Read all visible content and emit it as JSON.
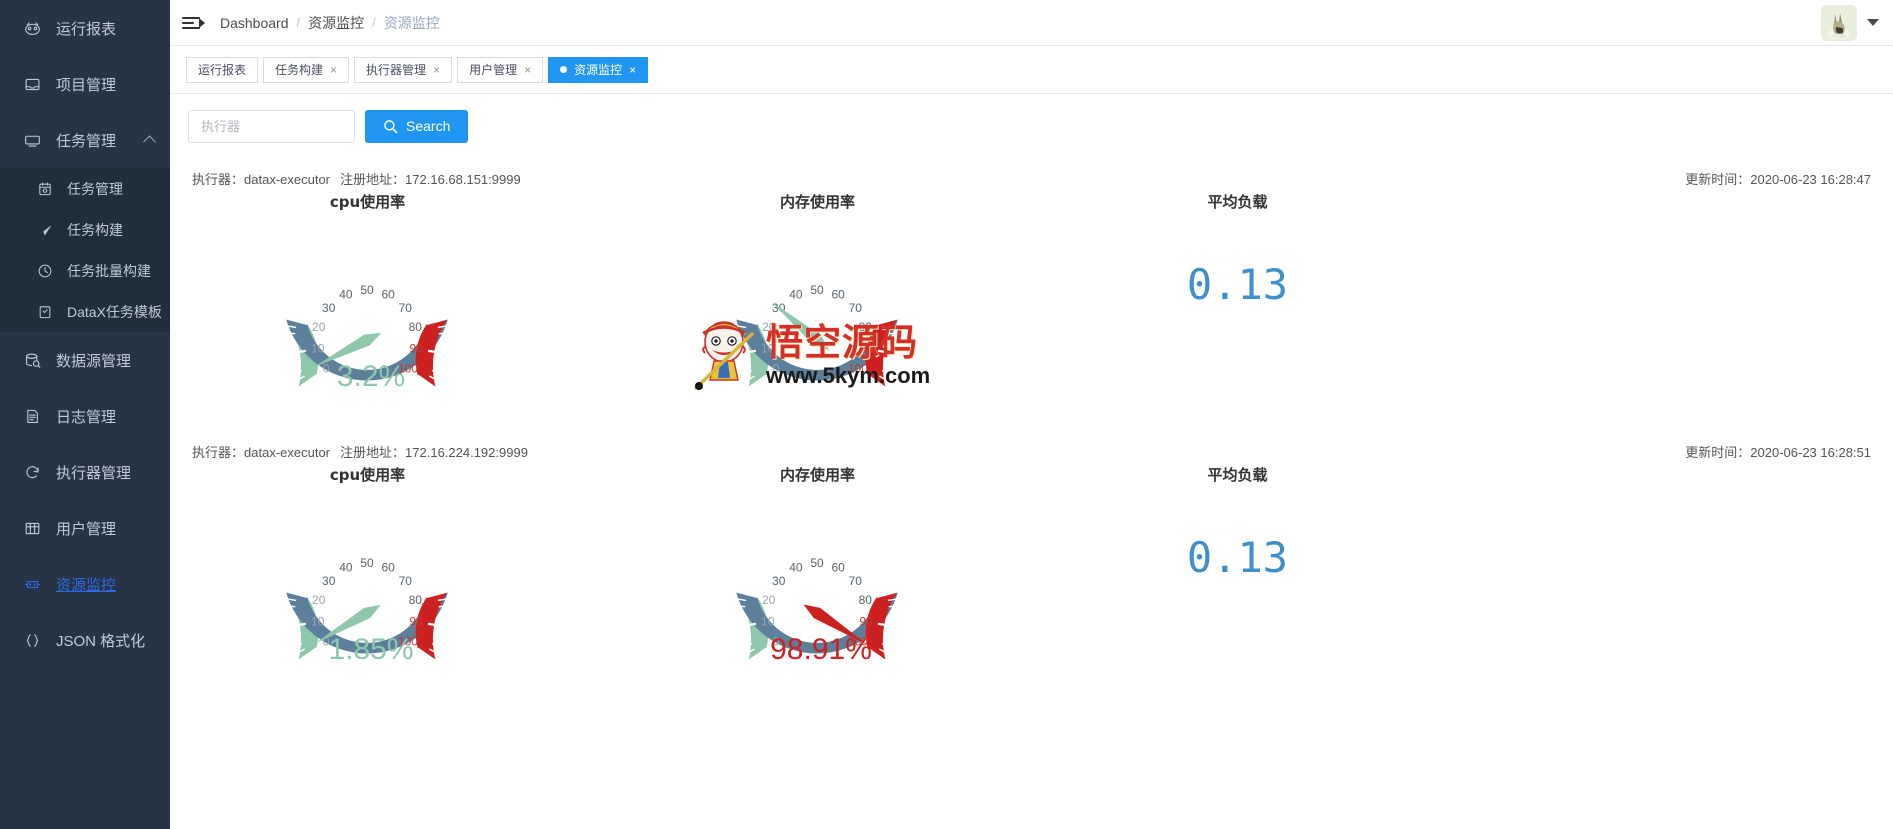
{
  "sidebar": {
    "items": [
      {
        "label": "运行报表",
        "icon": "dashboard-icon",
        "type": "item"
      },
      {
        "label": "项目管理",
        "icon": "project-icon",
        "type": "item"
      },
      {
        "label": "任务管理",
        "icon": "monitor-icon",
        "type": "group",
        "expanded": true,
        "children": [
          {
            "label": "任务管理",
            "icon": "calendar-icon"
          },
          {
            "label": "任务构建",
            "icon": "send-icon"
          },
          {
            "label": "任务批量构建",
            "icon": "clock-circle-icon"
          },
          {
            "label": "DataX任务模板",
            "icon": "template-icon"
          }
        ]
      },
      {
        "label": "数据源管理",
        "icon": "database-icon",
        "type": "item"
      },
      {
        "label": "日志管理",
        "icon": "document-icon",
        "type": "item"
      },
      {
        "label": "执行器管理",
        "icon": "refresh-icon",
        "type": "item"
      },
      {
        "label": "用户管理",
        "icon": "grid-icon",
        "type": "item"
      },
      {
        "label": "资源监控",
        "icon": "monitor-chip-icon",
        "type": "item",
        "active": true
      },
      {
        "label": "JSON 格式化",
        "icon": "braces-icon",
        "type": "item"
      }
    ]
  },
  "header": {
    "menu_icon": "hamburger-collapse-icon",
    "breadcrumb": [
      "Dashboard",
      "资源监控",
      "资源监控"
    ],
    "avatar_icon": "user-avatar",
    "avatar_caret_icon": "chevron-down-icon"
  },
  "tabs": [
    {
      "label": "运行报表",
      "closable": false,
      "active": false
    },
    {
      "label": "任务构建",
      "closable": true,
      "active": false
    },
    {
      "label": "执行器管理",
      "closable": true,
      "active": false
    },
    {
      "label": "用户管理",
      "closable": true,
      "active": false
    },
    {
      "label": "资源监控",
      "closable": true,
      "active": true
    }
  ],
  "tab_close_glyph": "×",
  "search": {
    "placeholder": "执行器",
    "value": "",
    "button_label": "Search",
    "button_icon": "search-icon"
  },
  "labels": {
    "executor_prefix": "执行器：",
    "address_prefix": "注册地址：",
    "updated_prefix": "更新时间：",
    "cpu_title": "cpu使用率",
    "mem_title": "内存使用率",
    "load_title": "平均负载"
  },
  "colors": {
    "accent": "#2095f2",
    "sidebar_bg": "#263445",
    "sidebar_sub_bg": "#1f2d3d",
    "gauge_green": "#8fc7ab",
    "gauge_blue": "#5c7f9c",
    "gauge_red": "#cd2121",
    "load_blue": "#3f8fcb"
  },
  "executors": [
    {
      "name": "datax-executor",
      "address": "172.16.68.151:9999",
      "updated": "2020-06-23 16:28:47",
      "cpu": {
        "value": 3.2,
        "display": "3.2%",
        "color": "#8fc7ab"
      },
      "mem": {
        "value": 30.0,
        "display": "",
        "color": "#8fc7ab"
      },
      "load": "0.13"
    },
    {
      "name": "datax-executor",
      "address": "172.16.224.192:9999",
      "updated": "2020-06-23 16:28:51",
      "cpu": {
        "value": 1.85,
        "display": "1.85%",
        "color": "#8fc7ab"
      },
      "mem": {
        "value": 98.91,
        "display": "98.91%",
        "color": "#cd2121"
      },
      "load": "0.13"
    }
  ],
  "chart_data": [
    {
      "type": "gauge",
      "title": "cpu使用率",
      "unit": "%",
      "ticks": [
        0,
        10,
        20,
        30,
        40,
        50,
        60,
        70,
        80,
        90,
        100
      ],
      "range": [
        0,
        100
      ],
      "value": 3.2,
      "value_label": "3.2%",
      "bands": [
        {
          "from": 0,
          "to": 20,
          "color": "#8fc7ab"
        },
        {
          "from": 20,
          "to": 80,
          "color": "#5c7f9c"
        },
        {
          "from": 80,
          "to": 100,
          "color": "#cd2121"
        }
      ],
      "executor": "datax-executor 172.16.68.151:9999"
    },
    {
      "type": "gauge",
      "title": "内存使用率",
      "unit": "%",
      "ticks": [
        0,
        10,
        20,
        30,
        40,
        50,
        60,
        70,
        80,
        90,
        100
      ],
      "range": [
        0,
        100
      ],
      "value": 30.0,
      "value_label": "",
      "bands": [
        {
          "from": 0,
          "to": 20,
          "color": "#8fc7ab"
        },
        {
          "from": 20,
          "to": 80,
          "color": "#5c7f9c"
        },
        {
          "from": 80,
          "to": 100,
          "color": "#cd2121"
        }
      ],
      "executor": "datax-executor 172.16.68.151:9999"
    },
    {
      "type": "number",
      "title": "平均负载",
      "value": 0.13,
      "value_label": "0.13",
      "executor": "datax-executor 172.16.68.151:9999"
    },
    {
      "type": "gauge",
      "title": "cpu使用率",
      "unit": "%",
      "ticks": [
        0,
        10,
        20,
        30,
        40,
        50,
        60,
        70,
        80,
        90,
        100
      ],
      "range": [
        0,
        100
      ],
      "value": 1.85,
      "value_label": "1.85%",
      "bands": [
        {
          "from": 0,
          "to": 20,
          "color": "#8fc7ab"
        },
        {
          "from": 20,
          "to": 80,
          "color": "#5c7f9c"
        },
        {
          "from": 80,
          "to": 100,
          "color": "#cd2121"
        }
      ],
      "executor": "datax-executor 172.16.224.192:9999"
    },
    {
      "type": "gauge",
      "title": "内存使用率",
      "unit": "%",
      "ticks": [
        0,
        10,
        20,
        30,
        40,
        50,
        60,
        70,
        80,
        90,
        100
      ],
      "range": [
        0,
        100
      ],
      "value": 98.91,
      "value_label": "98.91%",
      "bands": [
        {
          "from": 0,
          "to": 20,
          "color": "#8fc7ab"
        },
        {
          "from": 20,
          "to": 80,
          "color": "#5c7f9c"
        },
        {
          "from": 80,
          "to": 100,
          "color": "#cd2121"
        }
      ],
      "executor": "datax-executor 172.16.224.192:9999"
    },
    {
      "type": "number",
      "title": "平均负载",
      "value": 0.13,
      "value_label": "0.13",
      "executor": "datax-executor 172.16.224.192:9999"
    }
  ],
  "watermark": {
    "text": "悟空源码",
    "url": "www.5kym.com"
  }
}
